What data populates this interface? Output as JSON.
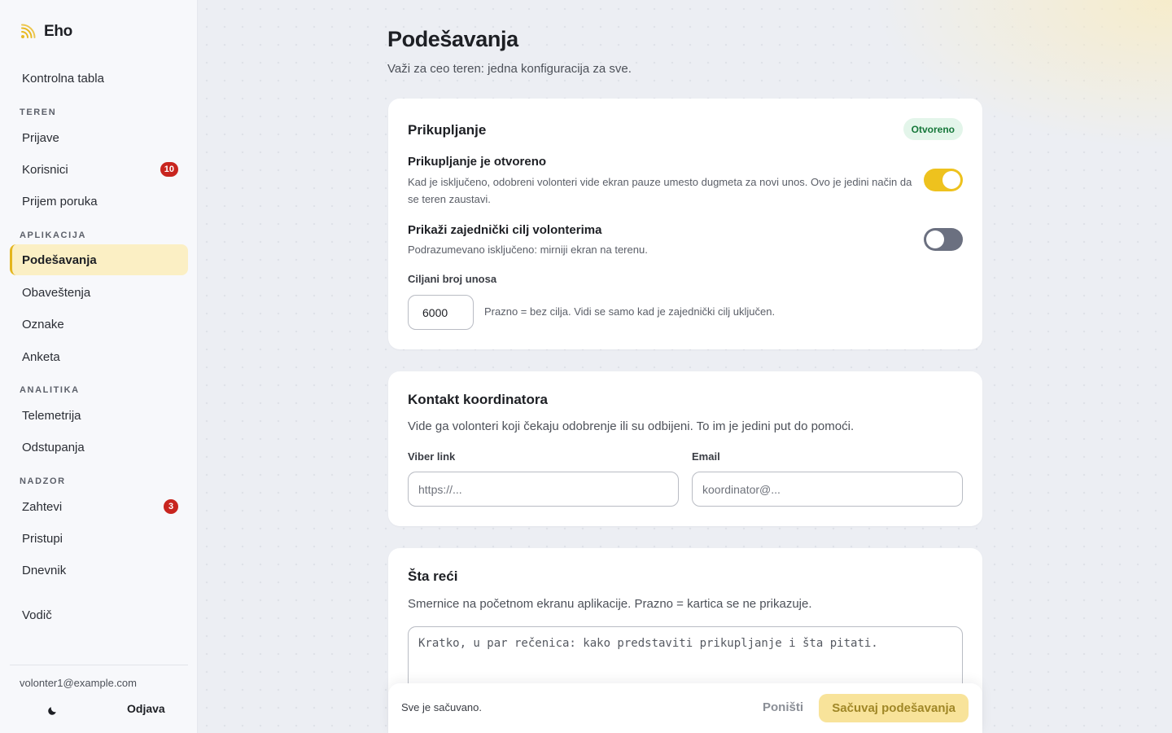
{
  "app": {
    "name": "Eho"
  },
  "sidebar": {
    "top": {
      "label": "Kontrolna tabla"
    },
    "sections": {
      "teren": "TEREN",
      "aplikacija": "APLIKACIJA",
      "analitika": "ANALITIKA",
      "nadzor": "NADZOR"
    },
    "items": {
      "prijave": {
        "label": "Prijave"
      },
      "korisnici": {
        "label": "Korisnici",
        "badge": "10"
      },
      "prijem_poruka": {
        "label": "Prijem poruka"
      },
      "podesavanja": {
        "label": "Podešavanja",
        "active": true
      },
      "obavestenja": {
        "label": "Obaveštenja"
      },
      "oznake": {
        "label": "Oznake"
      },
      "anketa": {
        "label": "Anketa"
      },
      "telemetrija": {
        "label": "Telemetrija"
      },
      "odstupanja": {
        "label": "Odstupanja"
      },
      "zahtevi": {
        "label": "Zahtevi",
        "badge": "3"
      },
      "pristupi": {
        "label": "Pristupi"
      },
      "dnevnik": {
        "label": "Dnevnik"
      },
      "vodic": {
        "label": "Vodič"
      }
    },
    "footer": {
      "email": "volonter1@example.com",
      "theme_icon": "moon-icon",
      "logout_label": "Odjava"
    }
  },
  "page": {
    "title": "Podešavanja",
    "subtitle": "Važi za ceo teren: jedna konfiguracija za sve."
  },
  "collection_card": {
    "title": "Prikupljanje",
    "status": "Otvoreno",
    "open_setting": {
      "title": "Prikupljanje je otvoreno",
      "description": "Kad je isključeno, odobreni volonteri vide ekran pauze umesto dugmeta za novi unos. Ovo je jedini način da se teren zaustavi.",
      "enabled": true
    },
    "goal_setting": {
      "title": "Prikaži zajednički cilj volonterima",
      "description": "Podrazumevano isključeno: mirniji ekran na terenu.",
      "enabled": false
    },
    "target": {
      "label": "Ciljani broj unosa",
      "value": "6000",
      "hint": "Prazno = bez cilja. Vidi se samo kad je zajednički cilj uključen."
    }
  },
  "contact_card": {
    "title": "Kontakt koordinatora",
    "description": "Vide ga volonteri koji čekaju odobrenje ili su odbijeni. To im je jedini put do pomoći.",
    "viber": {
      "label": "Viber link",
      "value": "",
      "placeholder": "https://..."
    },
    "email": {
      "label": "Email",
      "value": "",
      "placeholder": "koordinator@..."
    }
  },
  "script_card": {
    "title": "Šta reći",
    "description": "Smernice na početnom ekranu aplikacije. Prazno = kartica se ne prikazuje.",
    "placeholder": "Kratko, u par rečenica: kako predstaviti prikupljanje i šta pitati."
  },
  "savebar": {
    "status": "Sve je sačuvano.",
    "cancel_label": "Poništi",
    "save_label": "Sačuvaj podešavanja"
  },
  "colors": {
    "accent": "#eec21e",
    "active_nav_bg": "#fbefc4",
    "badge": "#c8251f",
    "status_green": "#16773a"
  }
}
